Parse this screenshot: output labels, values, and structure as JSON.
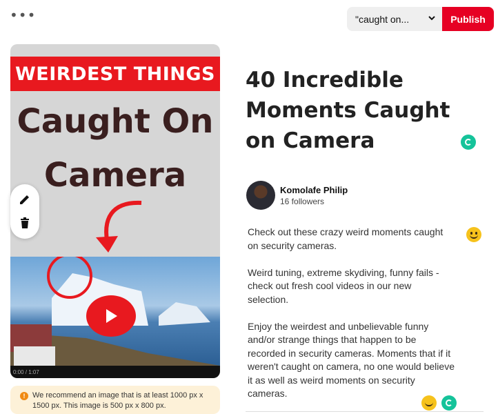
{
  "header": {
    "more_label": "•••",
    "board_select_value": "\"caught on...",
    "publish_label": "Publish"
  },
  "pin_image": {
    "banner_text": "WEIRDEST THINGS",
    "headline_line1": "Caught On",
    "headline_line2": "Camera",
    "video_time": "0:00 / 1:07"
  },
  "warning": {
    "text": "We recommend an image that is at least 1000 px x 1500 px. This image is 500 px x 800 px."
  },
  "pin": {
    "title": "40 Incredible Moments Caught on Camera",
    "author_name": "Komolafe Philip",
    "followers": "16 followers",
    "description": [
      "Check out these crazy weird moments caught on security cameras.",
      "Weird tuning, extreme skydiving, funny fails - check out fresh cool videos in our new selection.",
      "Enjoy the weirdest and unbelievable funny and/or strange things that happen to be recorded in security cameras. Moments that if it weren't caught on camera, no one would believe it as well as weird moments on security cameras."
    ]
  },
  "colors": {
    "publish_red": "#e60023",
    "banner_red": "#e8191f",
    "grammarly_green": "#15c39a"
  }
}
